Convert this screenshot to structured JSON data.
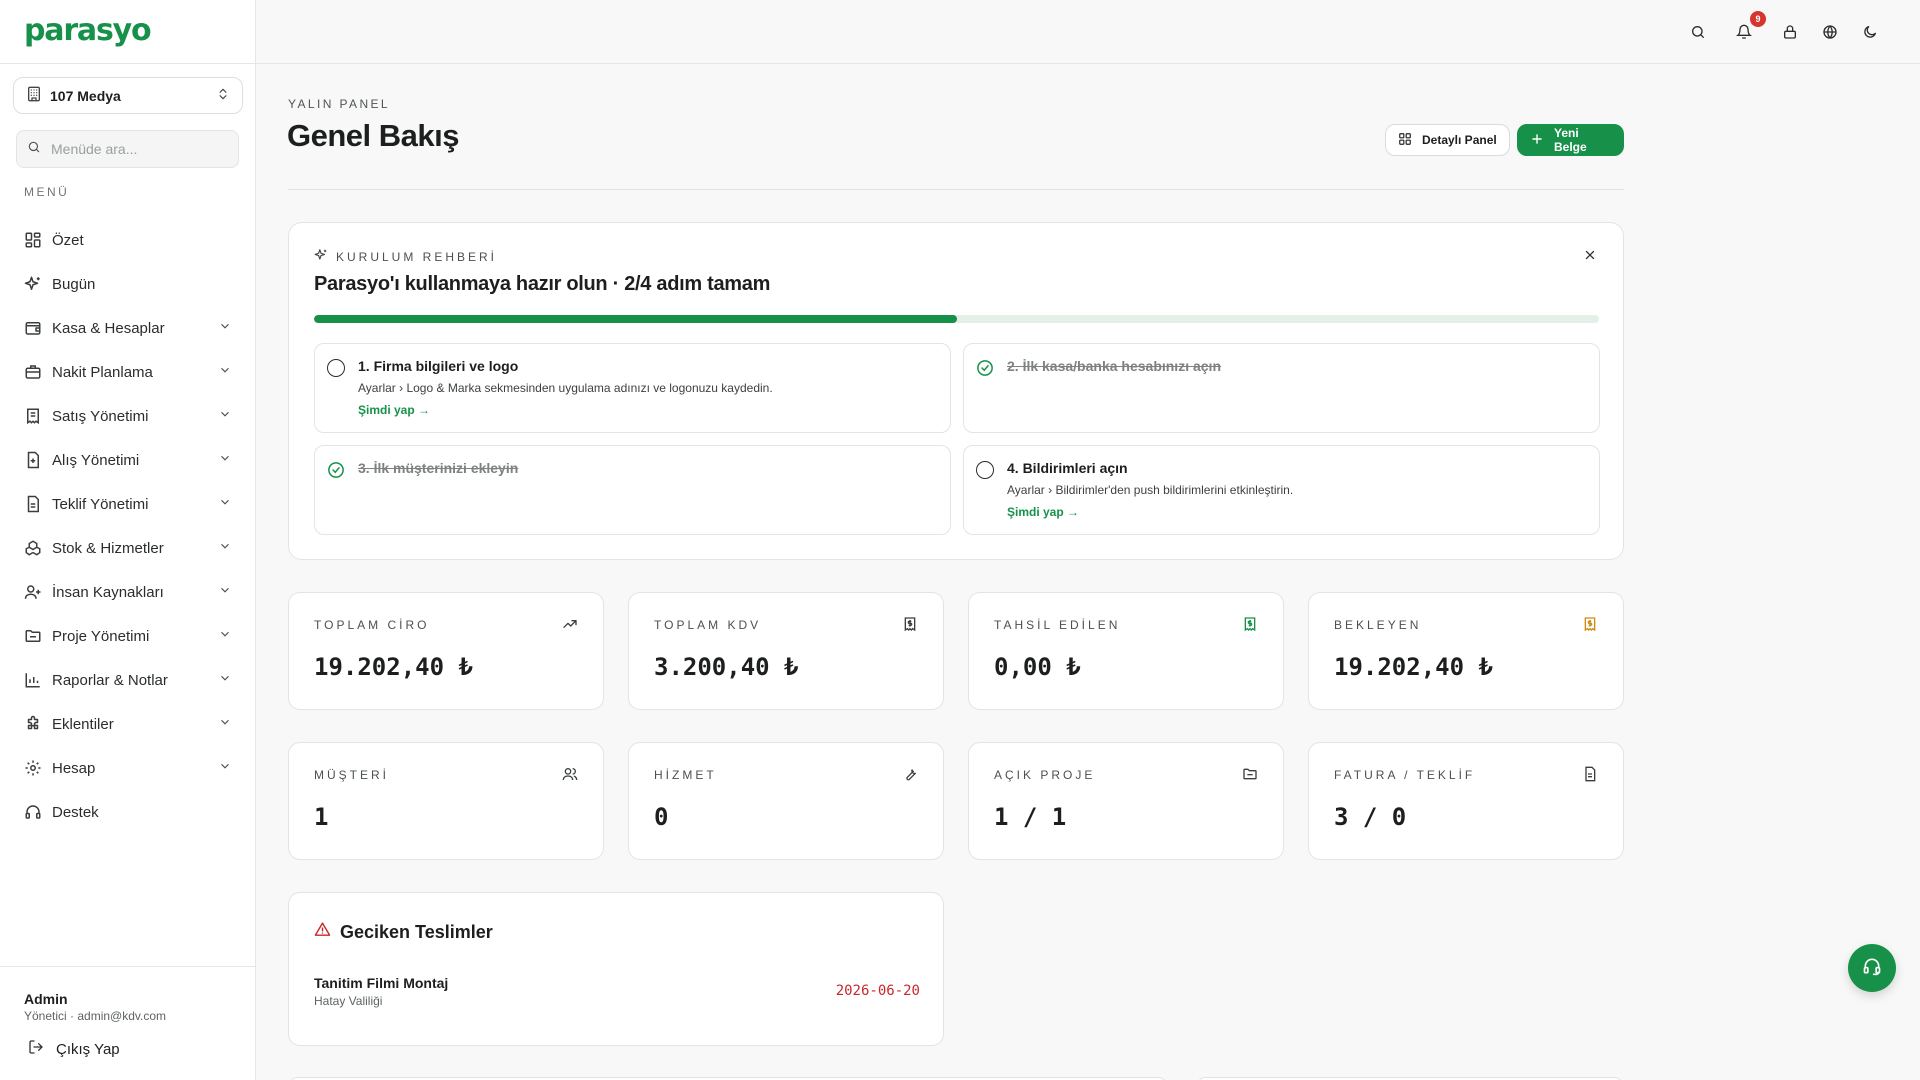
{
  "app": {
    "logo": "parasyo"
  },
  "company": {
    "name": "107 Medya"
  },
  "menu_search": {
    "placeholder": "Menüde ara..."
  },
  "menu_label": "MENÜ",
  "nav": [
    {
      "label": "Özet",
      "icon": "grid-icon",
      "expandable": false
    },
    {
      "label": "Bugün",
      "icon": "sparkles-icon",
      "expandable": false
    },
    {
      "label": "Kasa & Hesaplar",
      "icon": "wallet-icon",
      "expandable": true
    },
    {
      "label": "Nakit Planlama",
      "icon": "briefcase-icon",
      "expandable": true
    },
    {
      "label": "Satış Yönetimi",
      "icon": "receipt-icon",
      "expandable": true
    },
    {
      "label": "Alış Yönetimi",
      "icon": "receipt-plus-icon",
      "expandable": true
    },
    {
      "label": "Teklif Yönetimi",
      "icon": "file-text-icon",
      "expandable": true
    },
    {
      "label": "Stok & Hizmetler",
      "icon": "boxes-icon",
      "expandable": true
    },
    {
      "label": "İnsan Kaynakları",
      "icon": "users-icon",
      "expandable": true
    },
    {
      "label": "Proje Yönetimi",
      "icon": "folder-icon",
      "expandable": true
    },
    {
      "label": "Raporlar & Notlar",
      "icon": "bar-chart-icon",
      "expandable": true
    },
    {
      "label": "Eklentiler",
      "icon": "puzzle-icon",
      "expandable": true
    },
    {
      "label": "Hesap",
      "icon": "gear-icon",
      "expandable": true
    },
    {
      "label": "Destek",
      "icon": "headset-icon",
      "expandable": false
    }
  ],
  "profile": {
    "name": "Admin",
    "role": "Yönetici · admin@kdv.com",
    "logout": "Çıkış Yap"
  },
  "topbar": {
    "notification_count": "9"
  },
  "header": {
    "eyebrow": "YALIN PANEL",
    "title": "Genel Bakış",
    "detail_button": "Detaylı Panel",
    "new_button": "Yeni Belge"
  },
  "setup": {
    "eyebrow": "KURULUM REHBERİ",
    "title": "Parasyo'ı kullanmaya hazır olun · 2/4 adım tamam",
    "progress": 0.5,
    "steps": [
      {
        "title": "1. Firma bilgileri ve logo",
        "desc": "Ayarlar › Logo & Marka sekmesinden uygulama adınızı ve logonuzu kaydedin.",
        "link": "Şimdi yap →",
        "done": false
      },
      {
        "title": "2. İlk kasa/banka hesabınızı açın",
        "desc": "",
        "link": "",
        "done": true
      },
      {
        "title": "3. İlk müşterinizi ekleyin",
        "desc": "",
        "link": "",
        "done": true
      },
      {
        "title": "4. Bildirimleri açın",
        "desc": "Ayarlar › Bildirimler'den push bildirimlerini etkinleştirin.",
        "link": "Şimdi yap →",
        "done": false
      }
    ]
  },
  "stats": [
    {
      "label": "TOPLAM CİRO",
      "value": "19.202,40 ₺",
      "icon": "trending-up-icon",
      "color": "#3a3f3c"
    },
    {
      "label": "TOPLAM KDV",
      "value": "3.200,40 ₺",
      "icon": "receipt-icon",
      "color": "#3a3f3c"
    },
    {
      "label": "TAHSİL EDİLEN",
      "value": "0,00 ₺",
      "icon": "receipt-icon",
      "color": "#17914a"
    },
    {
      "label": "BEKLEYEN",
      "value": "19.202,40 ₺",
      "icon": "receipt-icon",
      "color": "#d18a10"
    },
    {
      "label": "MÜŞTERİ",
      "value": "1",
      "icon": "users-icon",
      "color": "#3a3f3c"
    },
    {
      "label": "HİZMET",
      "value": "0",
      "icon": "wrench-icon",
      "color": "#3a3f3c"
    },
    {
      "label": "AÇIK PROJE",
      "value": "1 / 1",
      "icon": "folder-icon",
      "color": "#3a3f3c"
    },
    {
      "label": "FATURA / TEKLİF",
      "value": "3 / 0",
      "icon": "file-text-icon",
      "color": "#3a3f3c"
    }
  ],
  "late": {
    "title": "Geciken Teslimler",
    "items": [
      {
        "title": "Tanitim Filmi Montaj",
        "sub": "Hatay Valiliği",
        "date": "2026-06-20"
      }
    ]
  },
  "colors": {
    "brand": "#17914a",
    "danger": "#c8282b",
    "warning": "#d18a10"
  }
}
